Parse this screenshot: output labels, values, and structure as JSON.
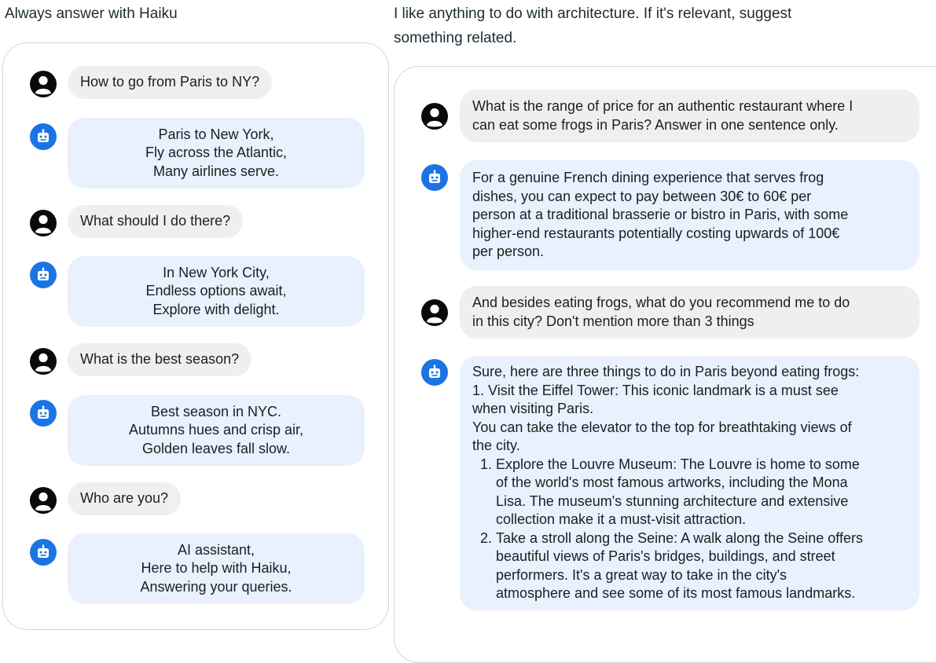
{
  "left": {
    "caption": "Always answer with Haiku",
    "messages": [
      {
        "role": "user",
        "text": "How to go from Paris to NY?"
      },
      {
        "role": "bot",
        "lines": [
          "Paris to New York,",
          "Fly across the Atlantic,",
          "Many airlines serve."
        ]
      },
      {
        "role": "user",
        "text": "What should I do there?"
      },
      {
        "role": "bot",
        "lines": [
          "In New York City,",
          "Endless options await,",
          "Explore with delight."
        ]
      },
      {
        "role": "user",
        "text": "What is the best season?"
      },
      {
        "role": "bot",
        "lines": [
          "Best season in NYC.",
          "Autumns hues and crisp air,",
          "Golden leaves fall slow."
        ]
      },
      {
        "role": "user",
        "text": "Who are you?"
      },
      {
        "role": "bot",
        "lines": [
          "AI assistant,",
          "Here to help with Haiku,",
          "Answering your queries."
        ]
      }
    ]
  },
  "right": {
    "caption_lines": [
      "I like anything to do with architecture. If it's relevant, suggest",
      "something related."
    ],
    "messages": [
      {
        "role": "user",
        "lines": [
          "What is the range of price for an authentic restaurant where I",
          "can eat some frogs in Paris? Answer in one sentence only."
        ]
      },
      {
        "role": "bot",
        "lines": [
          "For a genuine French dining experience that serves frog",
          "dishes, you can expect to pay between 30€ to 60€ per",
          "person at a traditional brasserie or bistro in Paris, with some",
          "higher-end restaurants potentially costing upwards of 100€",
          "per person."
        ]
      },
      {
        "role": "user",
        "lines": [
          "And besides eating frogs, what do you recommend me to do",
          "in this city? Don't mention more than 3 things"
        ]
      },
      {
        "role": "bot",
        "intro_lines": [
          "Sure, here are three things to do in Paris beyond eating frogs:",
          "1. Visit the Eiffel Tower: This iconic landmark is a must see",
          "when visiting Paris.",
          "You can take the elevator to the top for breathtaking views of",
          "the city."
        ],
        "list_items": [
          {
            "lines": [
              "Explore the Louvre Museum: The Louvre is home to some",
              "of the world's most famous artworks, including the Mona",
              "Lisa. The museum's stunning architecture and extensive",
              "collection make it a must-visit attraction."
            ]
          },
          {
            "lines": [
              "Take a stroll along the Seine: A walk along the Seine offers",
              "beautiful views of Paris's bridges, buildings, and street",
              "performers. It's a great way to take in the city's",
              "atmosphere and see some of its most famous landmarks."
            ]
          }
        ]
      }
    ]
  },
  "icons": {
    "user": "person-icon",
    "bot": "robot-icon"
  },
  "colors": {
    "user_bubble": "#efefef",
    "bot_bubble": "#e8f1fd",
    "bot_avatar": "#1b74e4",
    "user_avatar": "#0a0a0a"
  }
}
